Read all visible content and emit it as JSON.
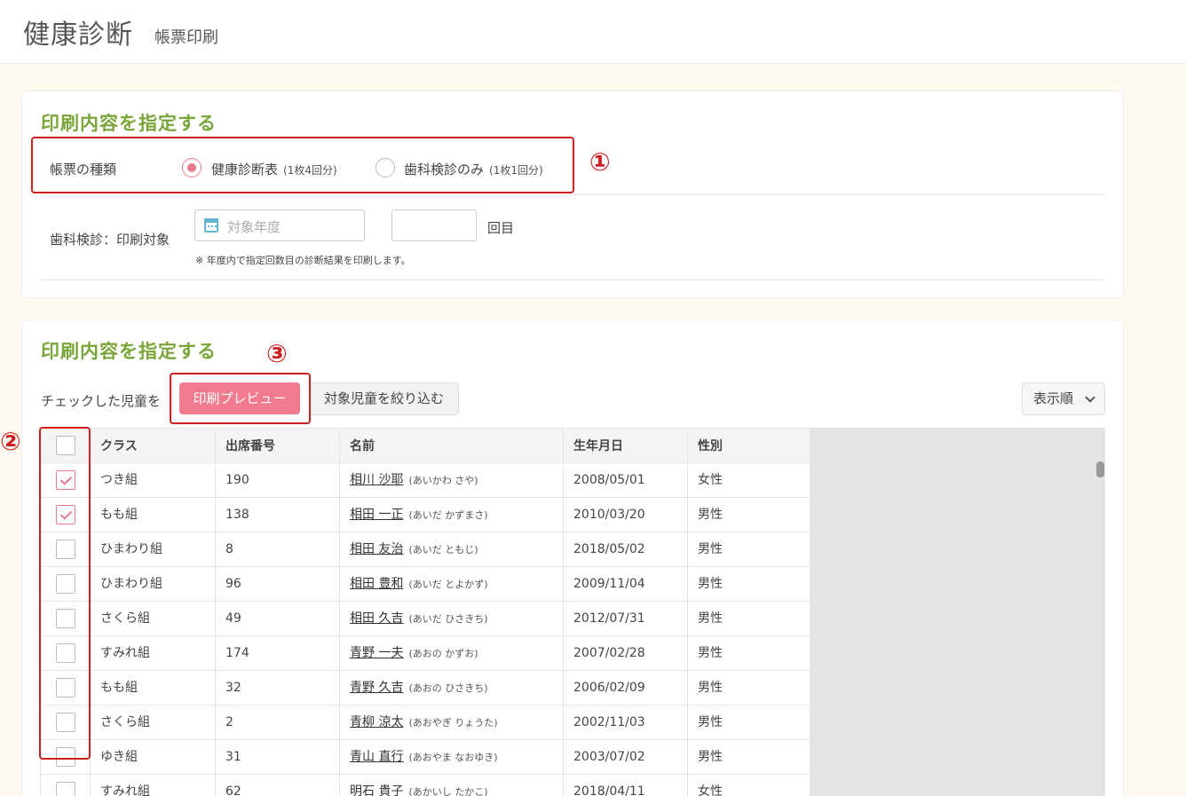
{
  "header": {
    "title": "健康診断",
    "subtitle": "帳票印刷"
  },
  "section1": {
    "title": "印刷内容を指定する",
    "form_type_label": "帳票の種類",
    "options": [
      {
        "label": "健康診断表",
        "note": "(1枚4回分)",
        "selected": true
      },
      {
        "label": "歯科検診のみ",
        "note": "(1枚1回分)",
        "selected": false
      }
    ],
    "dental_label": "歯科検診：印刷対象",
    "year_placeholder": "対象年度",
    "times_suffix": "回目",
    "note": "※ 年度内で指定回数目の診断結果を印刷します。"
  },
  "section2": {
    "title": "印刷内容を指定する",
    "checked_label": "チェックした児童を",
    "preview_button": "印刷プレビュー",
    "filter_button": "対象児童を絞り込む",
    "sort_button": "表示順"
  },
  "markers": {
    "m1": "①",
    "m2": "②",
    "m3": "③"
  },
  "table": {
    "headers": [
      "クラス",
      "出席番号",
      "名前",
      "生年月日",
      "性別"
    ],
    "rows": [
      {
        "checked": true,
        "class": "つき組",
        "no": "190",
        "name": "相川 沙耶",
        "kana": "(あいかわ さや)",
        "dob": "2008/05/01",
        "sex": "女性"
      },
      {
        "checked": true,
        "class": "もも組",
        "no": "138",
        "name": "相田 一正",
        "kana": "(あいだ かずまさ)",
        "dob": "2010/03/20",
        "sex": "男性"
      },
      {
        "checked": false,
        "class": "ひまわり組",
        "no": "8",
        "name": "相田 友治",
        "kana": "(あいだ ともじ)",
        "dob": "2018/05/02",
        "sex": "男性"
      },
      {
        "checked": false,
        "class": "ひまわり組",
        "no": "96",
        "name": "相田 豊和",
        "kana": "(あいだ とよかず)",
        "dob": "2009/11/04",
        "sex": "男性"
      },
      {
        "checked": false,
        "class": "さくら組",
        "no": "49",
        "name": "相田 久吉",
        "kana": "(あいだ ひさきち)",
        "dob": "2012/07/31",
        "sex": "男性"
      },
      {
        "checked": false,
        "class": "すみれ組",
        "no": "174",
        "name": "青野 一夫",
        "kana": "(あおの かずお)",
        "dob": "2007/02/28",
        "sex": "男性"
      },
      {
        "checked": false,
        "class": "もも組",
        "no": "32",
        "name": "青野 久吉",
        "kana": "(あおの ひさきち)",
        "dob": "2006/02/09",
        "sex": "男性"
      },
      {
        "checked": false,
        "class": "さくら組",
        "no": "2",
        "name": "青柳 涼太",
        "kana": "(あおやぎ りょうた)",
        "dob": "2002/11/03",
        "sex": "男性"
      },
      {
        "checked": false,
        "class": "ゆき組",
        "no": "31",
        "name": "青山 直行",
        "kana": "(あおやま なおゆき)",
        "dob": "2003/07/02",
        "sex": "男性"
      },
      {
        "checked": false,
        "class": "すみれ組",
        "no": "62",
        "name": "明石 貴子",
        "kana": "(あかいし たかこ)",
        "dob": "2018/04/11",
        "sex": "女性"
      }
    ]
  }
}
